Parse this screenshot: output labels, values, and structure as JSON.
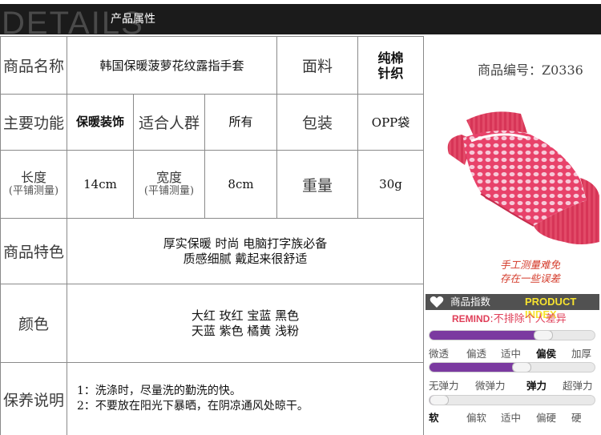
{
  "header": {
    "watermark": "DETAILS",
    "title": "产品属性"
  },
  "table": {
    "name_label": "商品名称",
    "name_value": "韩国保暖菠萝花纹露指手套",
    "fabric_label": "面料",
    "fabric_value_line1": "纯棉",
    "fabric_value_line2": "针织",
    "function_label": "主要功能",
    "function_value": "保暖装饰",
    "audience_label": "适合人群",
    "audience_value": "所有",
    "package_label": "包装",
    "package_value": "OPP袋",
    "length_label": "长度",
    "length_sub": "(平铺测量)",
    "length_value": "14cm",
    "width_label": "宽度",
    "width_sub": "(平铺测量)",
    "width_value": "8cm",
    "weight_label": "重量",
    "weight_value": "30g",
    "features_label": "商品特色",
    "features_line1": "厚实保暖 时尚  电脑打字族必备",
    "features_line2": "质感细腻 戴起来很舒适",
    "color_label": "颜色",
    "color_line1": "大红 玫红 宝蓝 黑色",
    "color_line2": "天蓝 紫色 橘黄 浅粉",
    "care_label": "保养说明",
    "care_line1": "1：洗涤时，尽量洗的勤洗的快。",
    "care_line2": "2：不要放在阳光下暴晒，在阴凉通风处晾干。"
  },
  "product": {
    "code": "商品编号：Z0336",
    "note_line1": "手工测量难免",
    "note_line2": "存在一些误差",
    "image_icon": "pink-fingerless-glove-photo",
    "glove_colors": {
      "body": "#e8426a",
      "pattern": "#f7c9d8",
      "cuff": "#d73557"
    }
  },
  "index": {
    "title_cn": "商品指数",
    "title_en": "PRODUCT INDEX",
    "remind_en": "REMIND",
    "remind_cn": ":不排除个人差异",
    "accent_color": "#7b3aa0",
    "scales": [
      {
        "labels": [
          "微透",
          "偏透",
          "适中",
          "偏侯",
          "加厚"
        ],
        "selected": 3,
        "level": 0.7
      },
      {
        "labels": [
          "无弹力",
          "微弹力",
          "弹力",
          "超弹力"
        ],
        "selected": 2,
        "level": 0.57
      },
      {
        "labels": [
          "软",
          "偏软",
          "适中",
          "偏硬",
          "硬"
        ],
        "selected": 0,
        "level": 0.05
      }
    ]
  }
}
